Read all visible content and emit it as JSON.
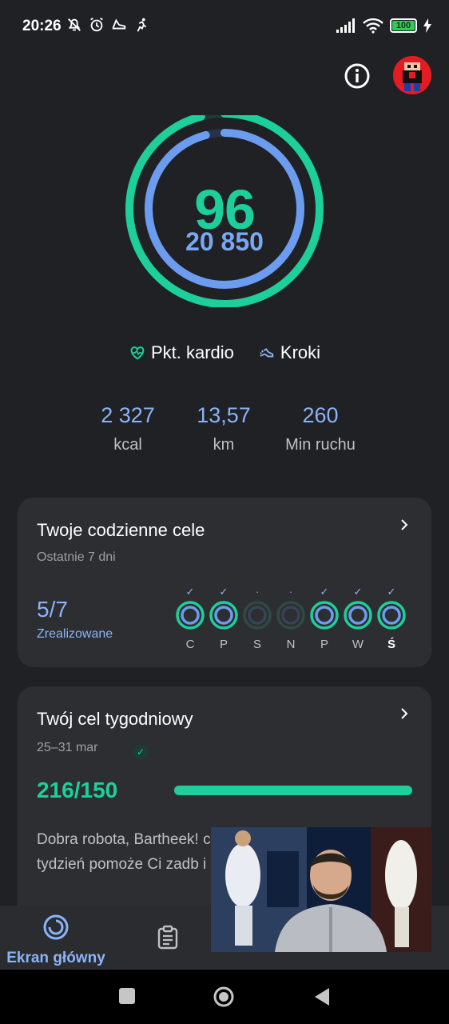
{
  "status_bar": {
    "time": "20:26",
    "battery": "100",
    "battery_level": 1.0
  },
  "header": {
    "info_icon": "info-icon",
    "avatar_icon": "avatar"
  },
  "rings": {
    "heart_points": "96",
    "steps": "20 850",
    "heart_points_progress": 0.96,
    "steps_progress": 0.96,
    "colors": {
      "heart": "#1ccf9b",
      "steps": "#6c9cf0"
    }
  },
  "legend": {
    "heart_label": "Pkt. kardio",
    "steps_label": "Kroki"
  },
  "stats": [
    {
      "value": "2 327",
      "label": "kcal"
    },
    {
      "value": "13,57",
      "label": "km"
    },
    {
      "value": "260",
      "label": "Min ruchu"
    }
  ],
  "daily_goals": {
    "title": "Twoje codzienne cele",
    "subtitle": "Ostatnie 7 dni",
    "count": "5/7",
    "count_label": "Zrealizowane",
    "days": [
      {
        "label": "C",
        "achieved": true,
        "today": false
      },
      {
        "label": "P",
        "achieved": true,
        "today": false
      },
      {
        "label": "S",
        "achieved": false,
        "today": false
      },
      {
        "label": "N",
        "achieved": false,
        "today": false
      },
      {
        "label": "P",
        "achieved": true,
        "today": false
      },
      {
        "label": "W",
        "achieved": true,
        "today": false
      },
      {
        "label": "Ś",
        "achieved": true,
        "today": true
      }
    ]
  },
  "weekly_goal": {
    "title": "Twój cel tygodniowy",
    "date_range": "25–31 mar",
    "value": "216/150",
    "progress": 1.0,
    "message": "Dobra robota, Bartheek! co najmniej 150 punktów tydzień pomoże Ci zadb i kondycję"
  },
  "bottom_nav": {
    "home_label": "Ekran główny"
  }
}
